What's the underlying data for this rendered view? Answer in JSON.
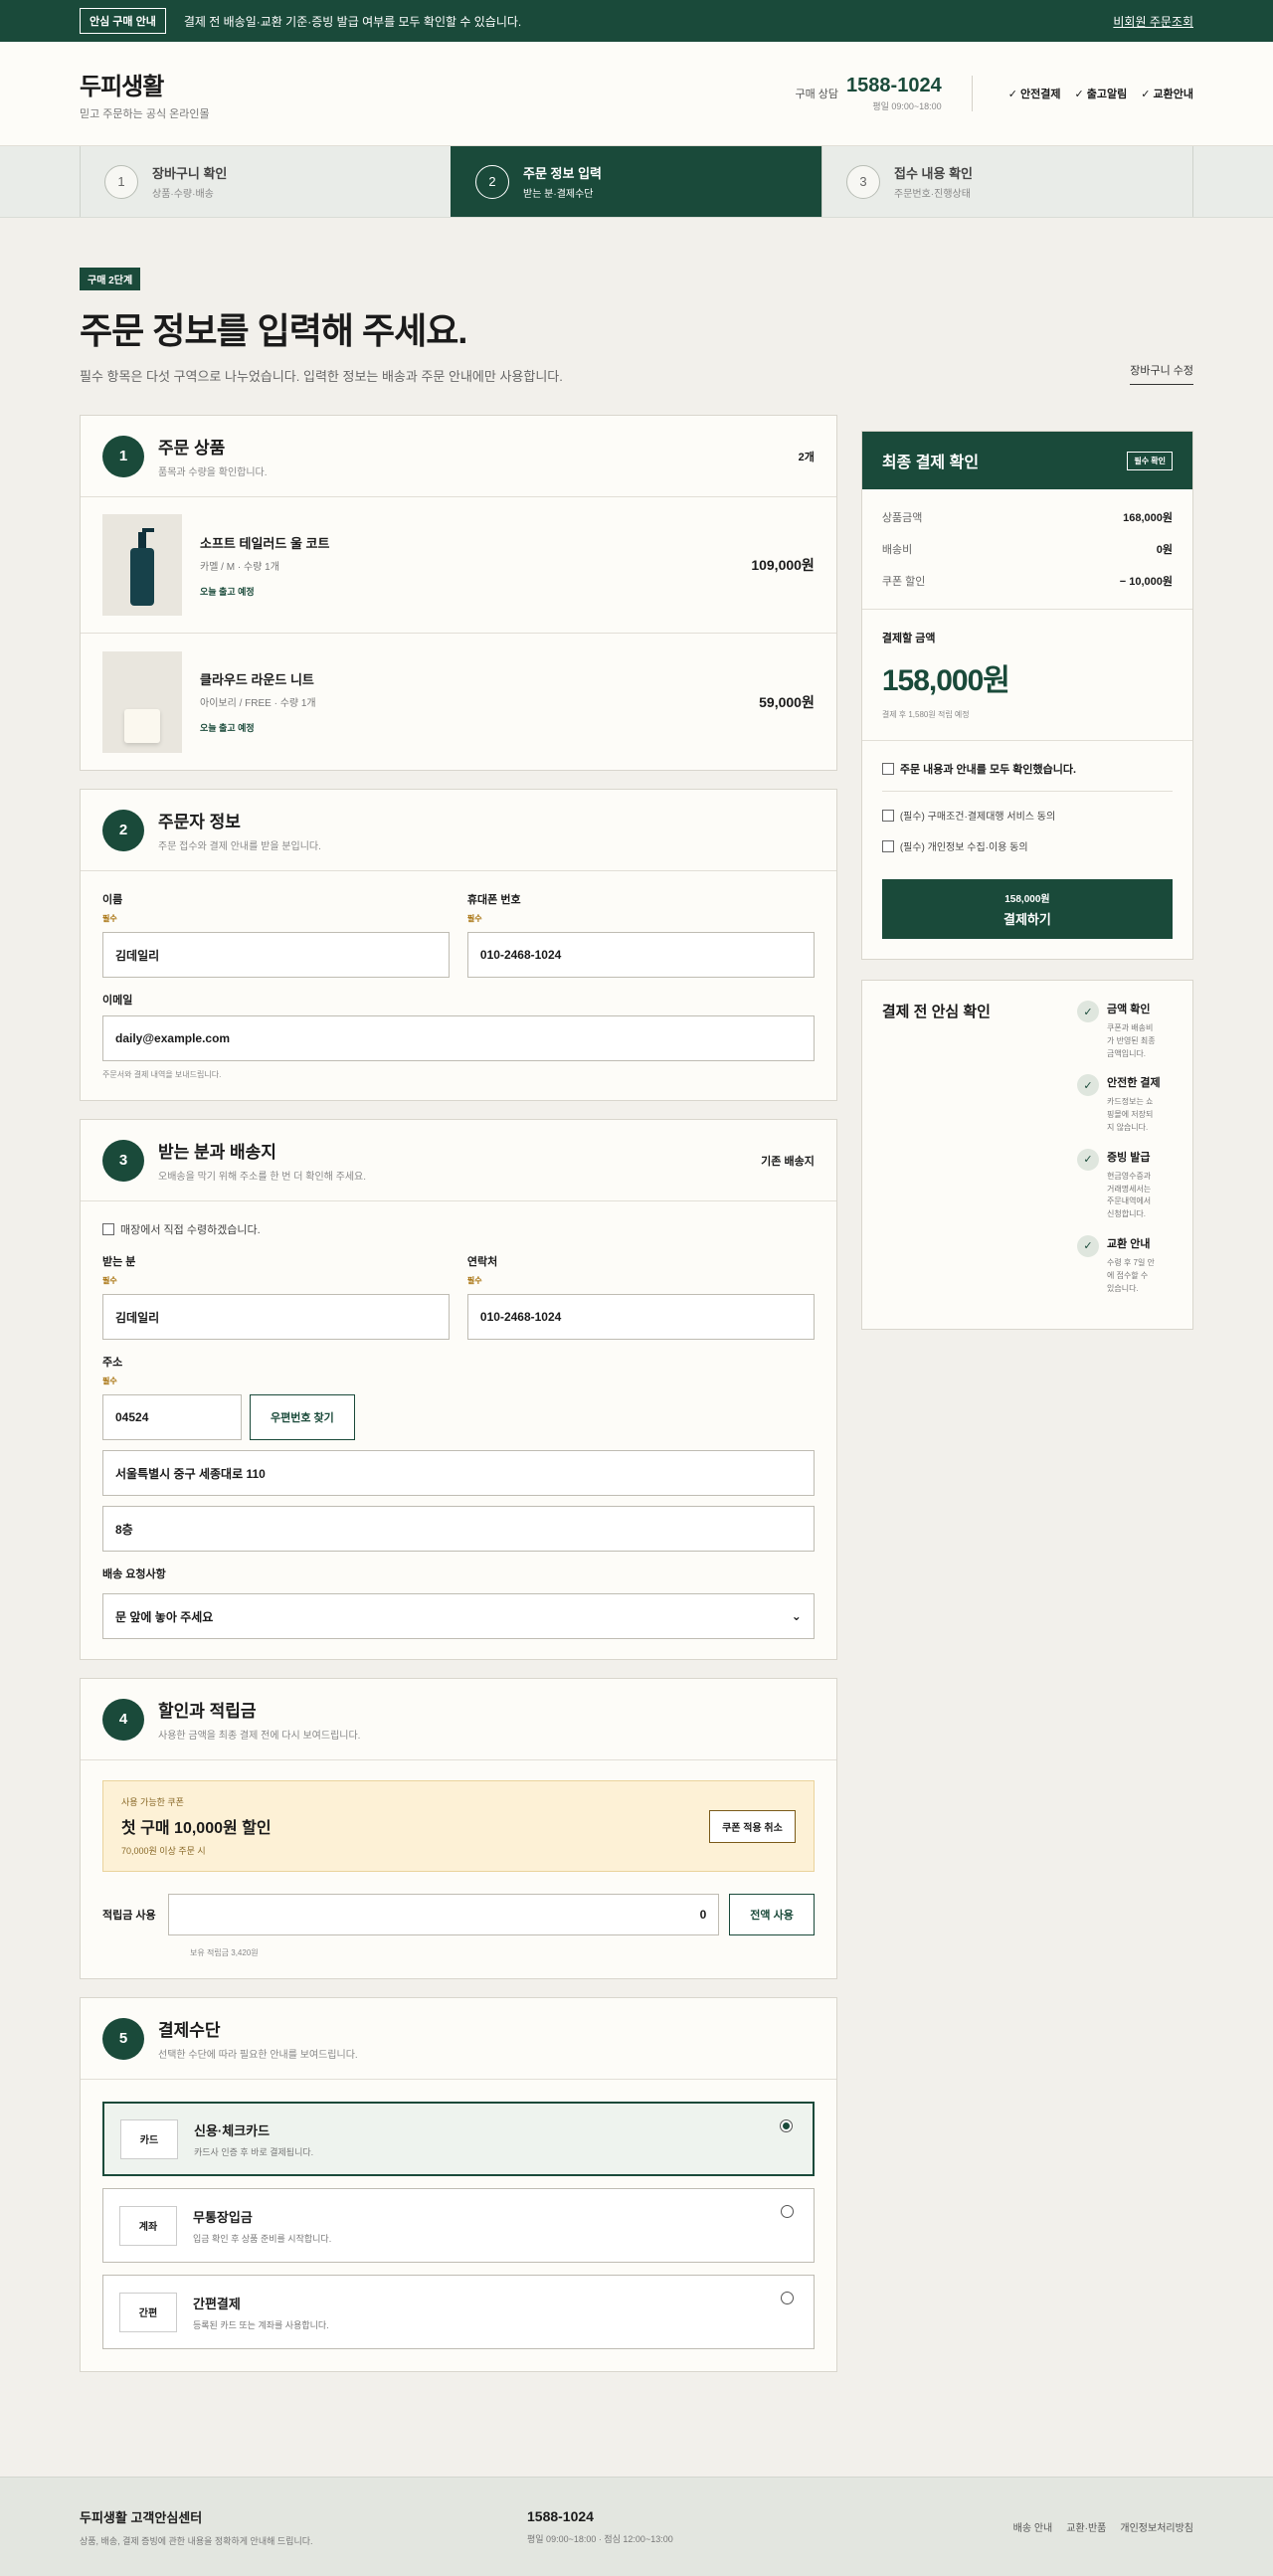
{
  "topbar": {
    "badge": "안심 구매 안내",
    "message": "결제 전 배송일·교환 기준·증빙 발급 여부를 모두 확인할 수 있습니다.",
    "link": "비회원 주문조회"
  },
  "header": {
    "logo": "두피생활",
    "tagline": "믿고 주문하는 공식 온라인몰",
    "contact_label": "구매 상담",
    "phone": "1588-1024",
    "hours": "평일 09:00~18:00",
    "trust": [
      "안전결제",
      "출고알림",
      "교환안내"
    ]
  },
  "steps": [
    {
      "num": "1",
      "title": "장바구니 확인",
      "sub": "상품·수량·배송"
    },
    {
      "num": "2",
      "title": "주문 정보 입력",
      "sub": "받는 분·결제수단"
    },
    {
      "num": "3",
      "title": "접수 내용 확인",
      "sub": "주문번호·진행상태"
    }
  ],
  "hero": {
    "chip": "구매 2단계",
    "title": "주문 정보를 입력해 주세요.",
    "desc": "필수 항목은 다섯 구역으로 나누었습니다. 입력한 정보는 배송과 주문 안내에만 사용합니다.",
    "edit_link": "장바구니 수정"
  },
  "sections": {
    "products": {
      "num": "1",
      "title": "주문 상품",
      "sub": "품목과 수량을 확인합니다.",
      "count": "2개",
      "items": [
        {
          "name": "소프트 테일러드 울 코트",
          "option": "카멜 / M · 수량 1개",
          "delivery": "오늘 출고 예정",
          "price": "109,000원",
          "image": "bottle"
        },
        {
          "name": "클라우드 라운드 니트",
          "option": "아이보리 / FREE · 수량 1개",
          "delivery": "오늘 출고 예정",
          "price": "59,000원",
          "image": "jar"
        }
      ]
    },
    "orderer": {
      "num": "2",
      "title": "주문자 정보",
      "sub": "주문 접수와 결제 안내를 받을 분입니다.",
      "name_label": "이름",
      "name_value": "김데일리",
      "phone_label": "휴대폰 번호",
      "phone_value": "010-2468-1024",
      "email_label": "이메일",
      "email_value": "daily@example.com",
      "email_hint": "주문서와 결제 내역을 보내드립니다.",
      "required": "필수"
    },
    "shipping": {
      "num": "3",
      "title": "받는 분과 배송지",
      "sub": "오배송을 막기 위해 주소를 한 번 더 확인해 주세요.",
      "right": "기존 배송지",
      "pickup": "매장에서 직접 수령하겠습니다.",
      "recv_label": "받는 분",
      "recv_value": "김데일리",
      "tel_label": "연락처",
      "tel_value": "010-2468-1024",
      "addr_label": "주소",
      "zip": "04524",
      "zip_button": "우편번호 찾기",
      "addr1": "서울특별시 중구 세종대로 110",
      "addr2": "8층",
      "memo_label": "배송 요청사항",
      "memo_value": "문 앞에 놓아 주세요",
      "required": "필수"
    },
    "discount": {
      "num": "4",
      "title": "할인과 적립금",
      "sub": "사용한 금액을 최종 결제 전에 다시 보여드립니다.",
      "coupon_kicker": "사용 가능한 쿠폰",
      "coupon_title": "첫 구매 10,000원 할인",
      "coupon_cond": "70,000원 이상 주문 시",
      "coupon_button": "쿠폰 적용 취소",
      "points_label": "적립금 사용",
      "points_value": "0",
      "points_button": "전액 사용",
      "points_hint": "보유 적립금 3,420원"
    },
    "payment": {
      "num": "5",
      "title": "결제수단",
      "sub": "선택한 수단에 따라 필요한 안내를 보여드립니다.",
      "methods": [
        {
          "tag": "카드",
          "name": "신용·체크카드",
          "desc": "카드사 인증 후 바로 결제됩니다.",
          "selected": true
        },
        {
          "tag": "계좌",
          "name": "무통장입금",
          "desc": "입금 확인 후 상품 준비를 시작합니다.",
          "selected": false
        },
        {
          "tag": "간편",
          "name": "간편결제",
          "desc": "등록된 카드 또는 계좌를 사용합니다.",
          "selected": false
        }
      ]
    }
  },
  "summary": {
    "title": "최종 결제 확인",
    "badge": "필수 확인",
    "rows": [
      {
        "k": "상품금액",
        "v": "168,000원"
      },
      {
        "k": "배송비",
        "v": "0원"
      },
      {
        "k": "쿠폰 할인",
        "v": "− 10,000원"
      }
    ],
    "total_label": "결제할 금액",
    "total": "158,000원",
    "points_note": "결제 후 1,580원 적립 예정",
    "agree_all": "주문 내용과 안내를 모두 확인했습니다.",
    "agree1": "(필수) 구매조건·결제대행 서비스 동의",
    "agree2": "(필수) 개인정보 수집·이용 동의",
    "pay_amount": "158,000원",
    "pay_label": "결제하기"
  },
  "safe": {
    "title": "결제 전 안심 확인",
    "items": [
      {
        "name": "금액 확인",
        "desc": "쿠폰과 배송비가 반영된 최종 금액입니다."
      },
      {
        "name": "안전한 결제",
        "desc": "카드정보는 쇼핑몰에 저장되지 않습니다."
      },
      {
        "name": "증빙 발급",
        "desc": "현금영수증과 거래명세서는 주문내역에서 신청합니다."
      },
      {
        "name": "교환 안내",
        "desc": "수령 후 7일 안에 접수할 수 있습니다."
      }
    ]
  },
  "footer": {
    "title": "두피생활 고객안심센터",
    "sub": "상품, 배송, 결제 증빙에 관한 내용을 정확하게 안내해 드립니다.",
    "phone": "1588-1024",
    "hours": "평일 09:00~18:00 · 점심 12:00~13:00",
    "links": [
      "배송 안내",
      "교환·반품",
      "개인정보처리방침"
    ]
  },
  "colors": {
    "brand": "#1a4a3a",
    "coupon_bg": "#fdf1d6",
    "page_bg": "#f2f0eb"
  }
}
